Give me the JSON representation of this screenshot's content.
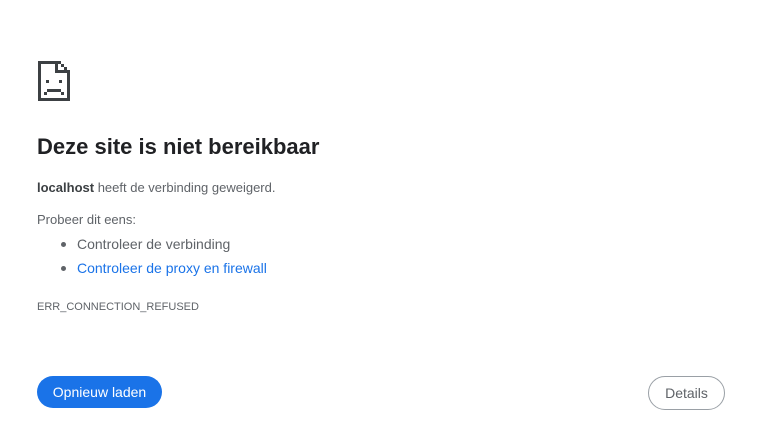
{
  "error_page": {
    "icon": "sad-document-icon",
    "title": "Deze site is niet bereikbaar",
    "host": "localhost",
    "message_suffix": " heeft de verbinding geweigerd.",
    "suggestions_label": "Probeer dit eens:",
    "suggestions": [
      {
        "label": "Controleer de verbinding",
        "is_link": false
      },
      {
        "label": "Controleer de proxy en firewall",
        "is_link": true
      }
    ],
    "error_code": "ERR_CONNECTION_REFUSED"
  },
  "buttons": {
    "reload_label": "Opnieuw laden",
    "details_label": "Details"
  },
  "colors": {
    "accent": "#1a73e8",
    "text": "#202124",
    "secondary_text": "#5f6368"
  }
}
